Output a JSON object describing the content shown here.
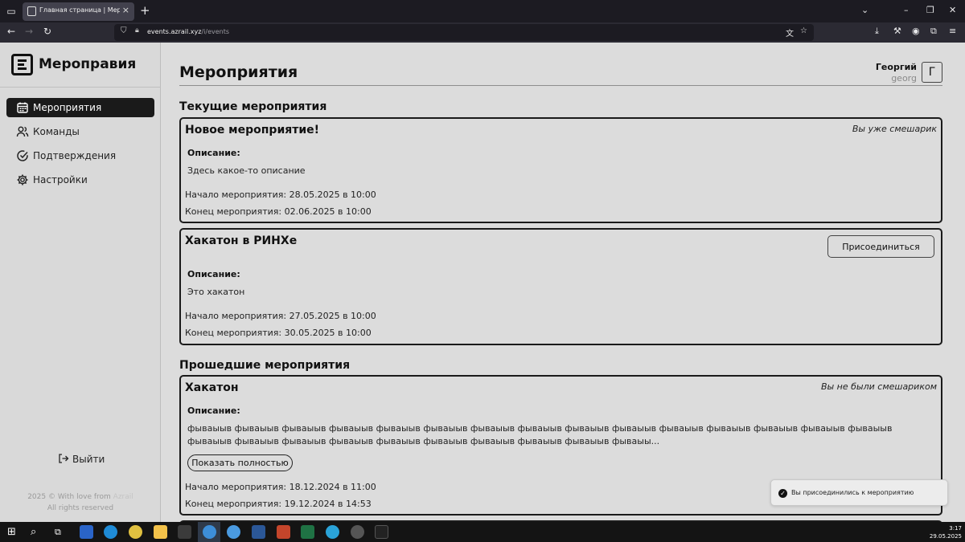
{
  "browser": {
    "tab_title": "Главная страница | Мероправ",
    "tab_close": "×",
    "new_tab": "+",
    "url_host": "events.azrail.xyz",
    "url_path": "/i/events",
    "window_controls": [
      "⌄",
      "–",
      "❐",
      "✕"
    ]
  },
  "sidebar": {
    "brand": "Мероправия",
    "items": [
      {
        "label": "Мероприятия",
        "icon": "calendar-icon",
        "active": true
      },
      {
        "label": "Команды",
        "icon": "users-icon",
        "active": false
      },
      {
        "label": "Подтверждения",
        "icon": "check-circle-icon",
        "active": false
      },
      {
        "label": "Настройки",
        "icon": "gear-icon",
        "active": false
      }
    ],
    "logout": "Выйти",
    "footer_line1_prefix": "2025 © With love from ",
    "footer_link": "Azrail",
    "footer_line2": "All rights reserved"
  },
  "header": {
    "title": "Мероприятия",
    "user_name": "Георгий",
    "user_login": "georg",
    "avatar_letter": "Г"
  },
  "sections": {
    "current": "Текущие мероприятия",
    "past": "Прошедшие мероприятия"
  },
  "events": [
    {
      "name": "Новое мероприятие!",
      "status": "Вы уже смешарик",
      "desc_label": "Описание:",
      "description": "Здесь какое-то описание",
      "start": "Начало мероприятия: 28.05.2025 в 10:00",
      "end": "Конец мероприятия: 02.06.2025 в 10:00"
    },
    {
      "name": "Хакатон в РИНХе",
      "join_button": "Присоединиться",
      "desc_label": "Описание:",
      "description": "Это хакатон",
      "start": "Начало мероприятия: 27.05.2025 в 10:00",
      "end": "Конец мероприятия: 30.05.2025 в 10:00"
    },
    {
      "name": "Хакатон",
      "status": "Вы не были смешариком",
      "desc_label": "Описание:",
      "description": "фываыыв фываыыв фываыыв фываыыв фываыыв фываыыв фываыыв фываыыв фываыыв фываыыв фываыыв фываыыв фываыыв фываыыв фываыыв фываыыв фываыыв фываыыв фываыыв фываыыв фываыыв фываыыв фываыыв фываыыв фываыы...",
      "show_full_button": "Показать полностью",
      "start": "Начало мероприятия: 18.12.2024 в 11:00",
      "end": "Конец мероприятия: 19.12.2024 в 14:53"
    }
  ],
  "toast": {
    "message": "Вы присоединились к мероприятию"
  },
  "taskbar": {
    "time": "3:17",
    "date": "29.05.2025"
  }
}
